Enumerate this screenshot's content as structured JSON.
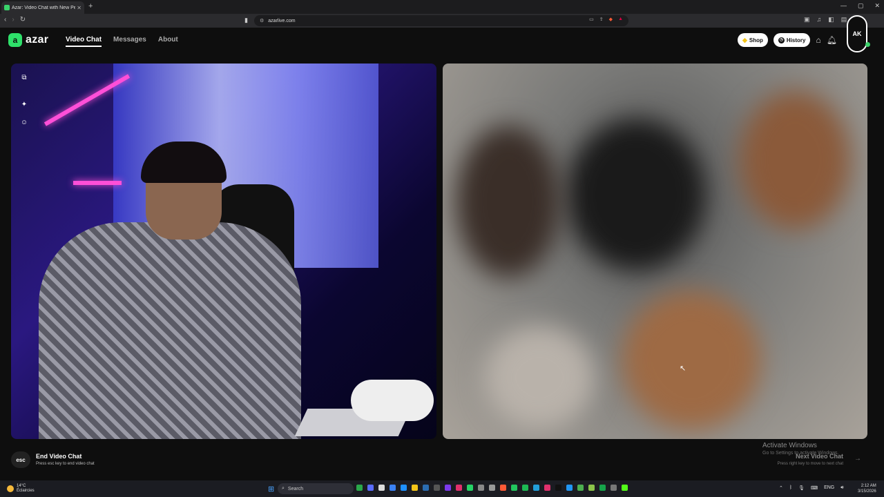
{
  "browser": {
    "tab_title": "Azar: Video Chat with New Pe",
    "tab_close": "✕",
    "new_tab": "+",
    "url": "azarlive.com",
    "window_controls": [
      "—",
      "▢",
      "✕"
    ]
  },
  "header": {
    "logo_mark": "a",
    "logo_text": "azar",
    "nav": [
      {
        "label": "Video Chat",
        "active": true
      },
      {
        "label": "Messages",
        "active": false
      },
      {
        "label": "About",
        "active": false
      }
    ],
    "shop_label": "Shop",
    "history_label": "History",
    "avatar_initials": "AK"
  },
  "footer": {
    "esc_key": "esc",
    "end_title": "End Video Chat",
    "end_sub": "Press esc key to end video chat",
    "next_title": "Next Video Chat",
    "next_sub": "Press right key to move to next chat"
  },
  "watermark": {
    "title": "Activate Windows",
    "sub": "Go to Settings to activate Windows."
  },
  "taskbar": {
    "weather_temp": "14°C",
    "weather_desc": "Éclaircies",
    "search_label": "Search",
    "lang": "ENG",
    "time": "2:12 AM",
    "date": "3/15/2026"
  },
  "colors": {
    "accent": "#2ee06a",
    "background": "#0e0e0e",
    "shop_gem": "#f5c518"
  },
  "icons": {
    "pip": "picture-in-picture-icon",
    "effects": "magic-wand-icon",
    "face": "face-filter-icon",
    "bell": "bell-icon",
    "store": "store-icon",
    "next": "arrow-right-icon"
  }
}
